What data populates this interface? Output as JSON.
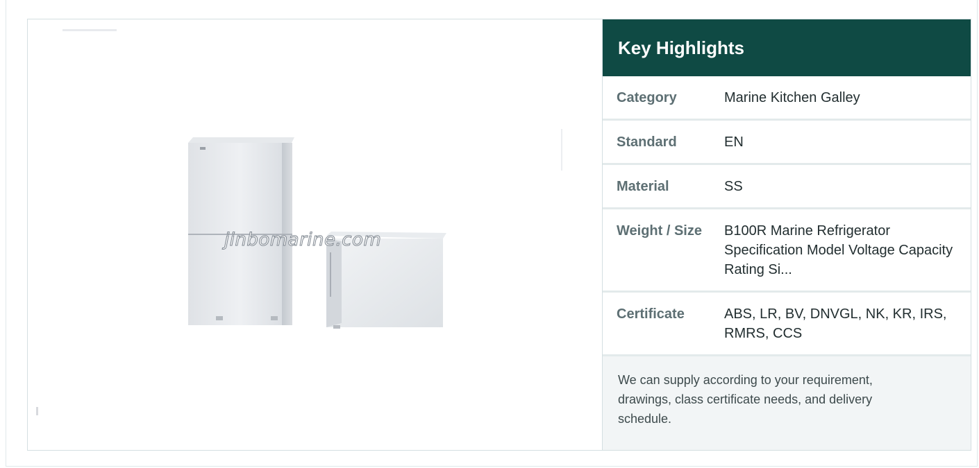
{
  "product_image": {
    "watermark": "jinbomarine.com",
    "icon": "refrigerator-product-photo"
  },
  "highlights": {
    "title": "Key Highlights",
    "rows": [
      {
        "label": "Category",
        "value": "Marine Kitchen Galley"
      },
      {
        "label": "Standard",
        "value": "EN"
      },
      {
        "label": "Material",
        "value": "SS"
      },
      {
        "label": "Weight / Size",
        "value": "B100R Marine Refrigerator Specification Model Voltage Capacity Rating Si..."
      },
      {
        "label": "Certificate",
        "value": "ABS, LR, BV, DNVGL, NK, KR, IRS, RMRS, CCS"
      }
    ],
    "note": "We can supply according to your requirement, drawings, class certificate needs, and delivery schedule."
  },
  "colors": {
    "header_bg": "#0f4a44",
    "note_bg": "#f2f5f6",
    "label_text": "#5d6f73"
  }
}
